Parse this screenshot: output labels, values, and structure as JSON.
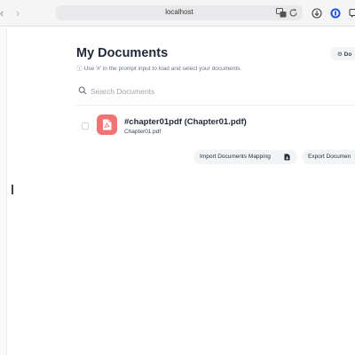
{
  "browser": {
    "url": "localhost",
    "back_icon": "chevron-left-icon",
    "forward_icon": "chevron-right-icon",
    "toolbar_icons": [
      "translate-icon",
      "reload-icon",
      "download-icon",
      "password-manager-icon",
      "extension-icon"
    ]
  },
  "page": {
    "title": "My Documents",
    "hint": "Use '#' in the prompt input to load and select your documents.",
    "settings_button": "Do"
  },
  "search": {
    "placeholder": "Search Documents",
    "value": ""
  },
  "documents": [
    {
      "title": "#chapter01pdf (Chapter01.pdf)",
      "filename": "Chapter01.pdf",
      "icon": "pdf-file-icon",
      "icon_color": "#f17373",
      "checked": false
    }
  ],
  "actions": {
    "import_label": "Import Documents Mapping",
    "export_label": "Export Documen"
  },
  "colors": {
    "accent_red": "#f17373",
    "button_bg": "#f3f4f6",
    "text_primary": "#1f2937",
    "text_muted": "#6b7280"
  }
}
